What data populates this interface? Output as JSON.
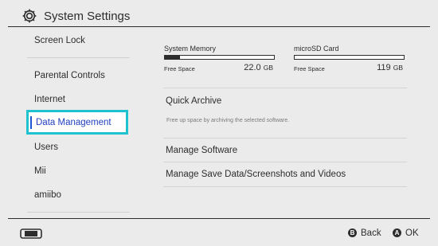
{
  "header": {
    "title": "System Settings",
    "icon": "gear-icon"
  },
  "sidebar": {
    "items": [
      {
        "label": "Screen Lock"
      },
      {
        "label": "Parental Controls"
      },
      {
        "label": "Internet"
      },
      {
        "label": "Data Management",
        "selected": true
      },
      {
        "label": "Users"
      },
      {
        "label": "Mii"
      },
      {
        "label": "amiibo"
      }
    ]
  },
  "storage": {
    "system": {
      "name": "System Memory",
      "free_label": "Free Space",
      "size": "22.0",
      "unit": "GB",
      "used_fraction": 0.14
    },
    "sd": {
      "name": "microSD Card",
      "free_label": "Free Space",
      "size": "119",
      "unit": "GB",
      "used_fraction": 0.0
    }
  },
  "menu": {
    "quick_archive": "Quick Archive",
    "quick_archive_desc": "Free up space by archiving the selected software.",
    "manage_software": "Manage Software",
    "manage_save": "Manage Save Data/Screenshots and Videos"
  },
  "footer": {
    "back": {
      "glyph": "B",
      "label": "Back"
    },
    "ok": {
      "glyph": "A",
      "label": "OK"
    }
  },
  "colors": {
    "accent": "#1fc3cf",
    "selected_text": "#1f3fbf",
    "background": "#ebebeb",
    "text": "#2d2d2d"
  }
}
